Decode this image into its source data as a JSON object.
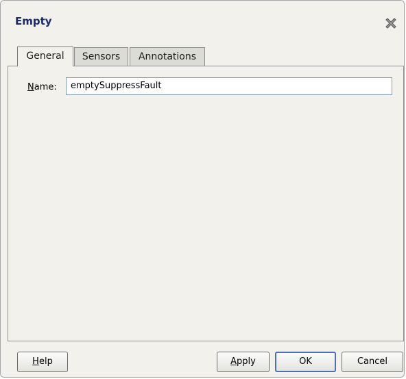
{
  "dialog": {
    "title": "Empty",
    "close_icon": "close-x-icon"
  },
  "tabs": [
    {
      "label": "General",
      "active": true
    },
    {
      "label": "Sensors",
      "active": false
    },
    {
      "label": "Annotations",
      "active": false
    }
  ],
  "general": {
    "name_label_mnemonic": "N",
    "name_label_rest": "ame:",
    "name_value": "emptySuppressFault"
  },
  "buttons": {
    "help_mnemonic": "H",
    "help_rest": "elp",
    "apply_mnemonic": "A",
    "apply_rest": "pply",
    "ok": "OK",
    "cancel": "Cancel"
  }
}
